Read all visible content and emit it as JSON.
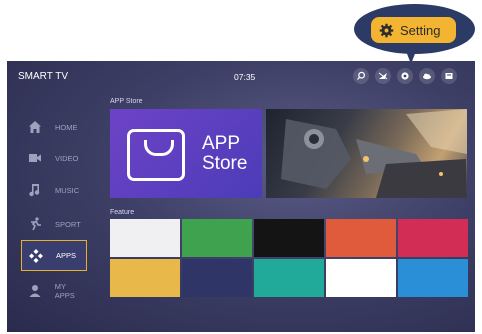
{
  "callout": {
    "setting_label": "Setting"
  },
  "header": {
    "title": "SMART TV",
    "time": "07:35"
  },
  "status_icons": [
    "search-icon",
    "signal-icon",
    "gear-icon",
    "cloud-icon",
    "storage-icon"
  ],
  "sidebar": {
    "items": [
      {
        "label": "HOME",
        "icon": "home-icon"
      },
      {
        "label": "VIDEO",
        "icon": "video-icon"
      },
      {
        "label": "MUSIC",
        "icon": "music-icon"
      },
      {
        "label": "SPORT",
        "icon": "sport-icon"
      },
      {
        "label": "APPS",
        "icon": "apps-icon",
        "active": true
      },
      {
        "label": "MY APPS",
        "icon": "user-icon"
      }
    ]
  },
  "main": {
    "app_store_section_label": "APP Store",
    "app_store_tile": {
      "line1": "APP",
      "line2": "Store"
    },
    "feature_section_label": "Feature",
    "feature_tiles": [
      {
        "color": "#f0f0f2"
      },
      {
        "color": "#3ea24e"
      },
      {
        "color": "#141414"
      },
      {
        "color": "#e05a3c"
      },
      {
        "color": "#d12d55"
      },
      {
        "color": "#e8b84a"
      },
      {
        "color": "#2f3566"
      },
      {
        "color": "#21a99a"
      },
      {
        "color": "#ffffff"
      },
      {
        "color": "#2a8fd6"
      }
    ]
  },
  "colors": {
    "accent": "#f2b431",
    "active_border": "#e6b12d",
    "callout_bg": "#2b3b66"
  }
}
